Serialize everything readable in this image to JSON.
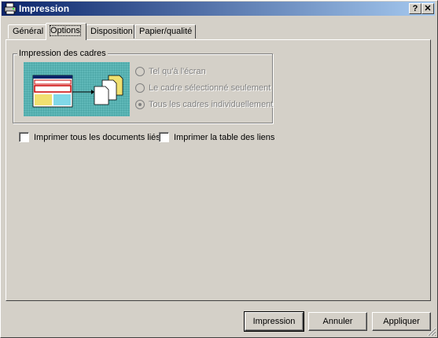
{
  "window": {
    "title": "Impression",
    "help_label": "?",
    "close_label": "✕",
    "icon": "printer-icon"
  },
  "tabs": [
    {
      "label": "Général",
      "active": false
    },
    {
      "label": "Options",
      "active": true
    },
    {
      "label": "Disposition",
      "active": false
    },
    {
      "label": "Papier/qualité",
      "active": false
    }
  ],
  "frames_group": {
    "legend": "Impression des cadres",
    "options": [
      {
        "label": "Tel qu'à l'écran",
        "checked": false,
        "enabled": false
      },
      {
        "label": "Le cadre sélectionné seulement",
        "checked": false,
        "enabled": false
      },
      {
        "label": "Tous les cadres individuellement",
        "checked": true,
        "enabled": false
      }
    ]
  },
  "checkboxes": [
    {
      "label": "Imprimer tous les documents liés",
      "checked": false
    },
    {
      "label": "Imprimer la table des liens",
      "checked": false
    }
  ],
  "buttons": {
    "print": "Impression",
    "cancel": "Annuler",
    "apply": "Appliquer"
  },
  "colors": {
    "titlebar_start": "#0a246a",
    "titlebar_end": "#a6caf0",
    "face": "#d4d0c8",
    "illustration_bg": "#5fb8b8"
  }
}
